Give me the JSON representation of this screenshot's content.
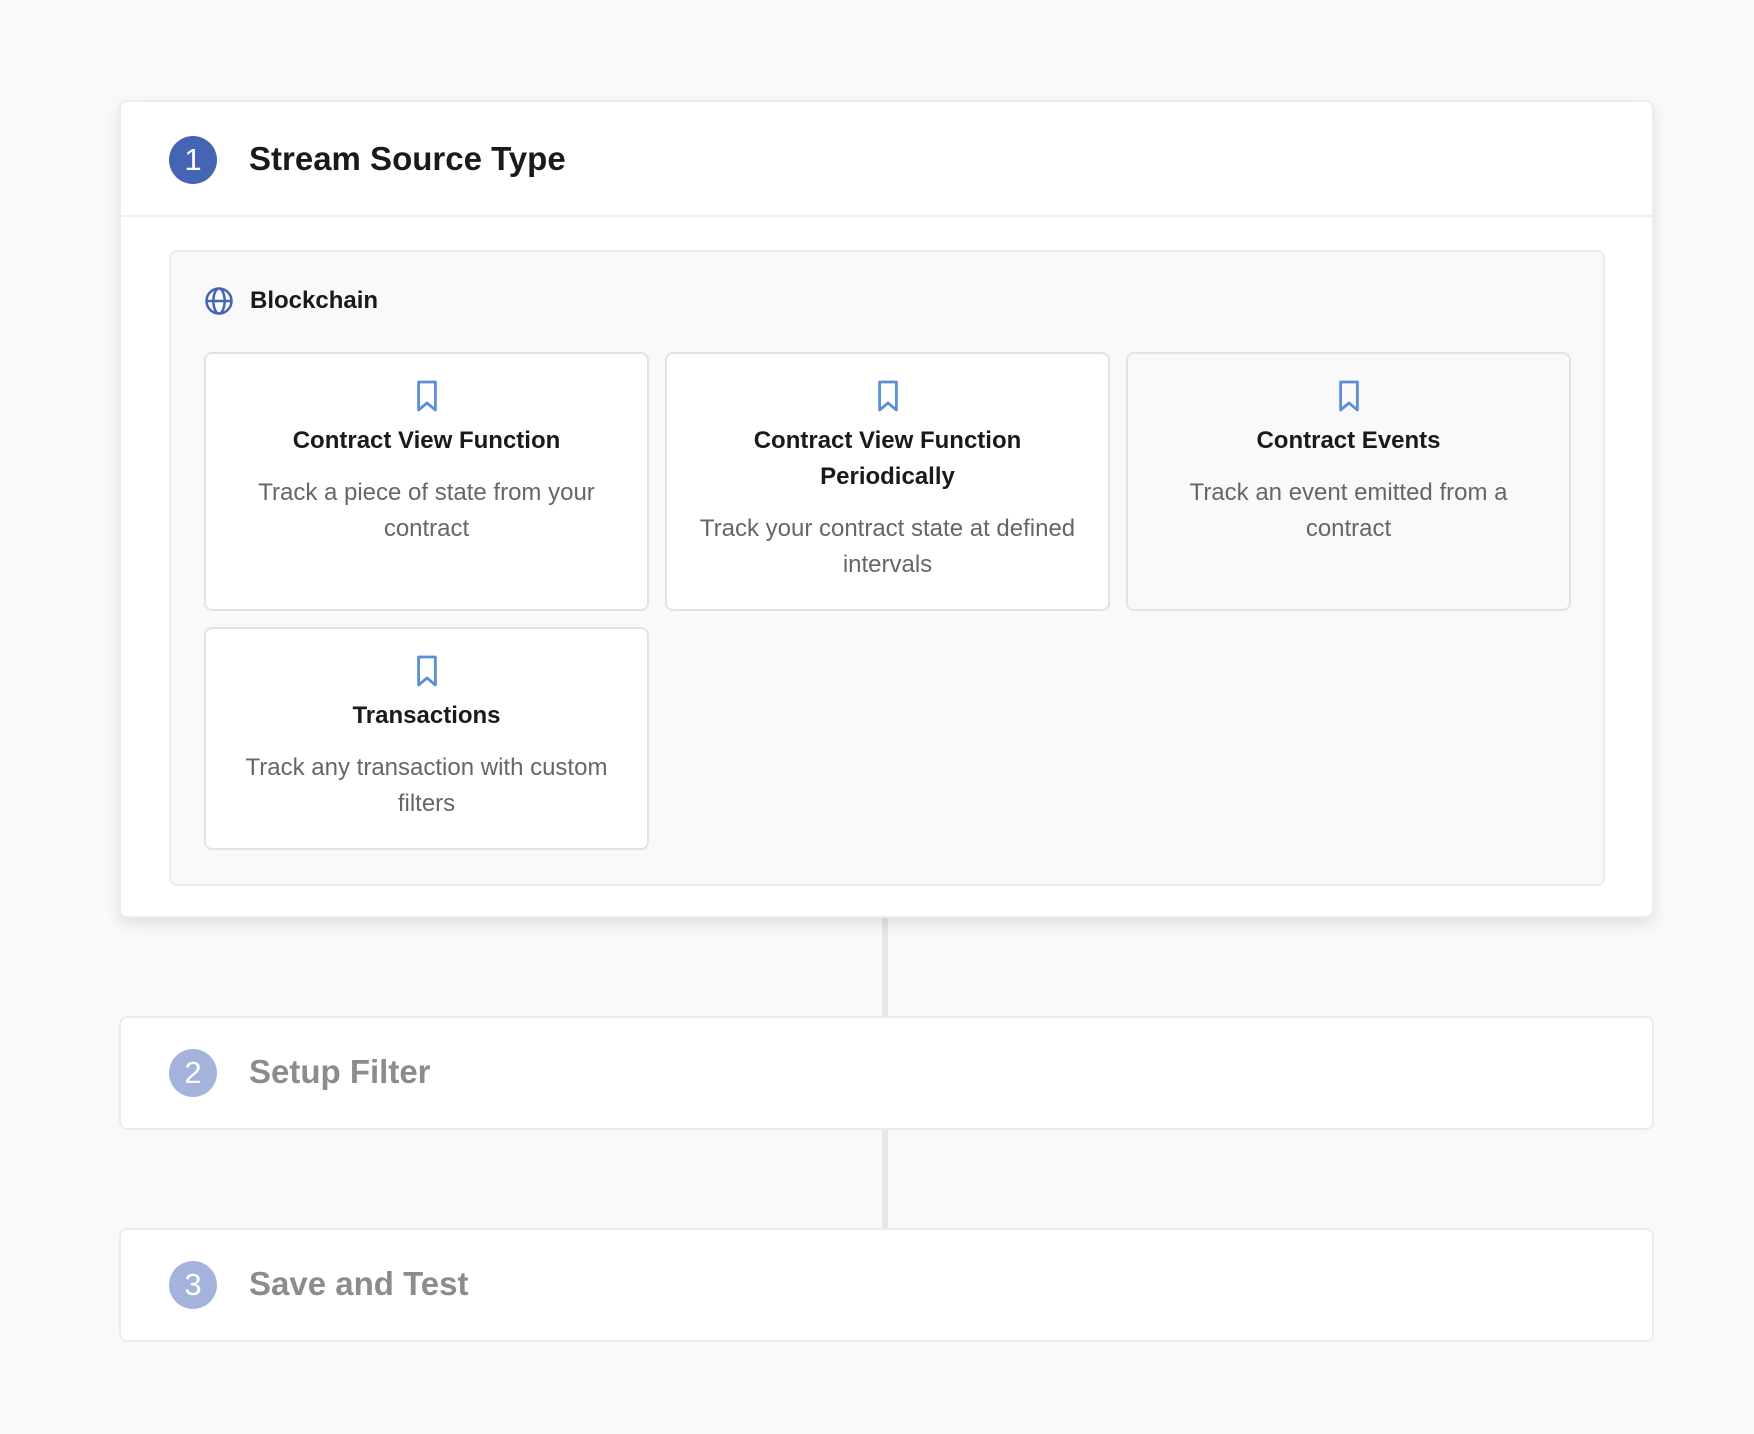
{
  "steps": [
    {
      "number": "1",
      "title": "Stream Source Type"
    },
    {
      "number": "2",
      "title": "Setup Filter"
    },
    {
      "number": "3",
      "title": "Save and Test"
    }
  ],
  "source": {
    "category": {
      "label": "Blockchain",
      "icon": "globe-icon"
    },
    "options": [
      {
        "title": "Contract View Function",
        "description": "Track a piece of state from your contract",
        "icon": "bookmark-icon"
      },
      {
        "title": "Contract View Function Periodically",
        "description": "Track your contract state at defined intervals",
        "icon": "bookmark-icon"
      },
      {
        "title": "Contract Events",
        "description": "Track an event emitted from a contract",
        "icon": "bookmark-icon"
      },
      {
        "title": "Transactions",
        "description": "Track any transaction with custom filters",
        "icon": "bookmark-icon"
      }
    ]
  },
  "colors": {
    "accent": "#4664b4",
    "accent_inactive": "#a3b3dc",
    "icon_blue": "#5a8fd6",
    "muted_text": "#8c8c8c"
  }
}
